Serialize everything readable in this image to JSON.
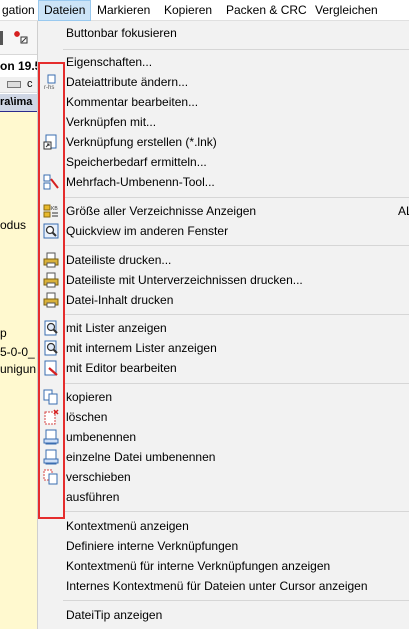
{
  "menubar": {
    "items": [
      {
        "label": "gation",
        "active": false
      },
      {
        "label": "Dateien",
        "active": true
      },
      {
        "label": "Markieren",
        "active": false
      },
      {
        "label": "Kopieren",
        "active": false
      },
      {
        "label": "Packen & CRC",
        "active": false
      },
      {
        "label": "Vergleichen",
        "active": false
      }
    ]
  },
  "background": {
    "panel_title": "on 19.5",
    "drive_letter": "c",
    "path": "ra\\ima",
    "list_texts": [
      "odus",
      "p",
      "5-0-0_",
      "unigun"
    ]
  },
  "menu": {
    "items": {
      "buttonbar_focus": "Buttonbar fokusieren",
      "properties": "Eigenschaften...",
      "change_attributes": "Dateiattribute ändern...",
      "edit_comment": "Kommentar bearbeiten...",
      "link_with": "Verknüpfen mit...",
      "create_shortcut": "Verknüpfung erstellen (*.lnk)",
      "calc_space": "Speicherbedarf ermitteln...",
      "multi_rename": "Mehrfach-Umbenenn-Tool...",
      "show_dir_sizes": "Größe aller Verzeichnisse Anzeigen",
      "show_dir_sizes_shortcut": "AL",
      "quickview": "Quickview im anderen Fenster",
      "print_list": "Dateiliste drucken...",
      "print_list_subdirs": "Dateiliste mit Unterverzeichnissen drucken...",
      "print_content": "Datei-Inhalt drucken",
      "view_lister": "mit Lister anzeigen",
      "view_internal_lister": "mit internem Lister anzeigen",
      "edit_with_editor": "mit Editor bearbeiten",
      "copy": "kopieren",
      "delete": "löschen",
      "rename": "umbenennen",
      "rename_single": "einzelne Datei umbenennen",
      "move": "verschieben",
      "execute": "ausführen",
      "show_context_menu": "Kontextmenü anzeigen",
      "define_internal_assoc": "Definiere interne Verknüpfungen",
      "context_internal_assoc": "Kontextmenü für interne Verknüpfungen anzeigen",
      "internal_context_cursor": "Internes Kontextmenü für Dateien unter Cursor anzeigen",
      "show_filetip": "DateiTip anzeigen"
    }
  },
  "colors": {
    "accent_red": "#e52d2d",
    "menu_bg": "#f2f2f2",
    "list_bg": "#fff9cf",
    "menubar_active": "#cce4f7"
  }
}
